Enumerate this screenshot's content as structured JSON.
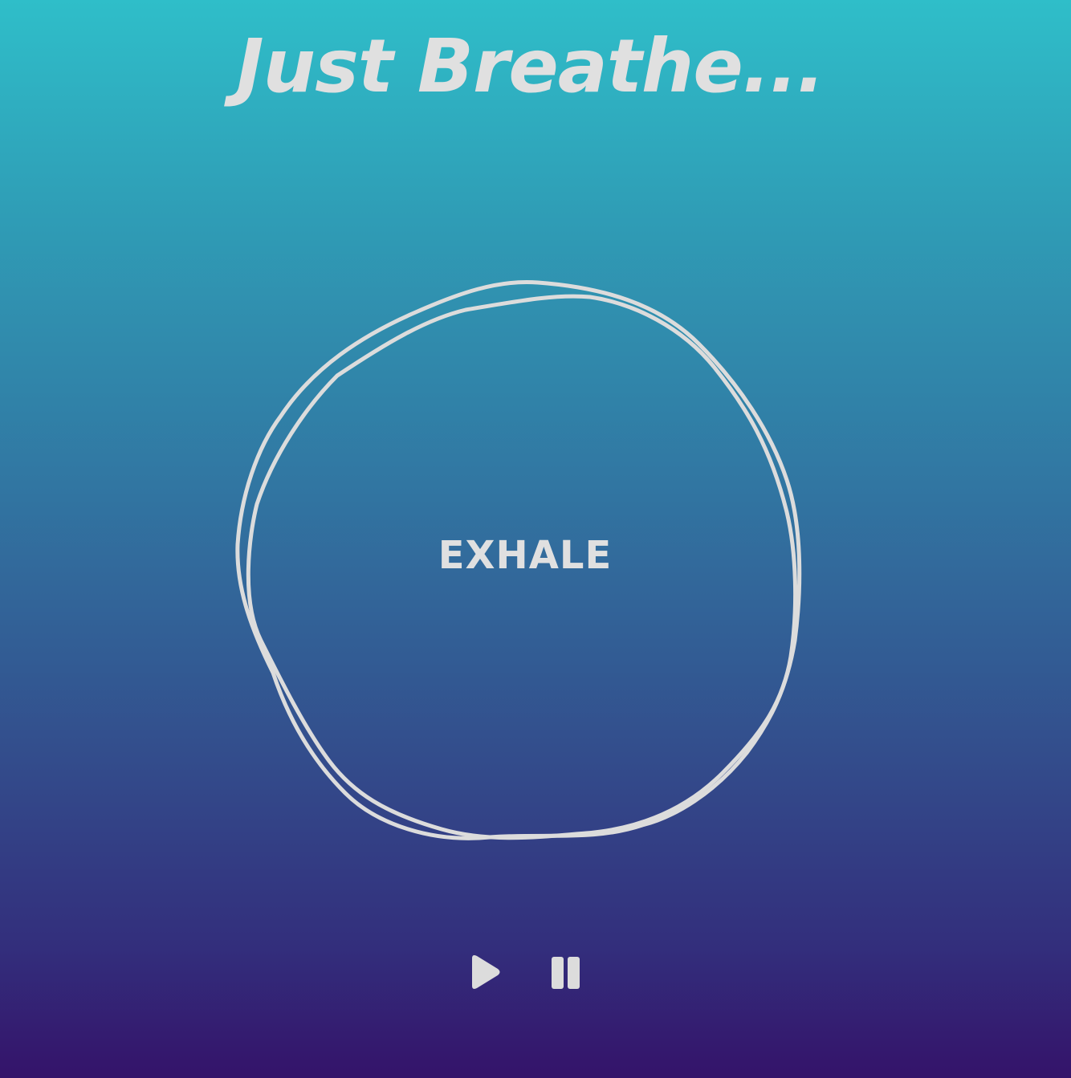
{
  "app": {
    "title": "Just Breathe..."
  },
  "breathing": {
    "phase": "EXHALE"
  },
  "controls": {
    "play_icon": "play-icon",
    "pause_icon": "pause-icon"
  },
  "colors": {
    "gradient_top": "#2fbec9",
    "gradient_bottom": "#34136a",
    "foreground": "#e0e0e0"
  }
}
